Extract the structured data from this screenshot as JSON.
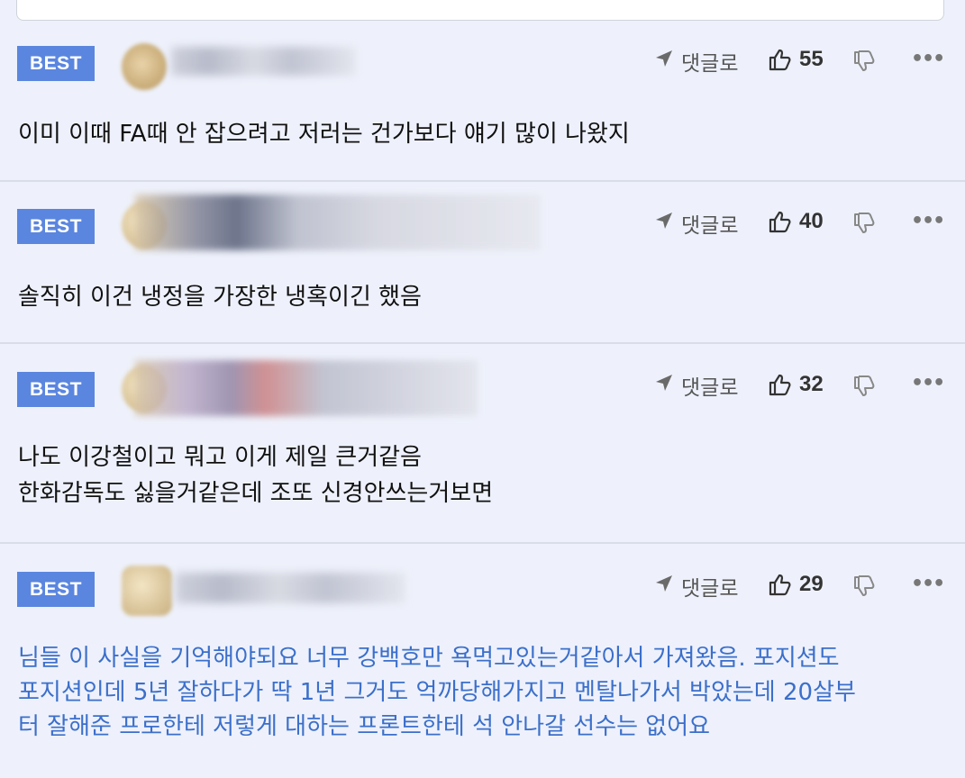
{
  "comments": [
    {
      "badge": "BEST",
      "reply_label": "댓글로",
      "likes": "55",
      "more": "•••",
      "text": "이미 이때 FA때 안 잡으려고 저러는 건가보다 얘기 많이 나왔지"
    },
    {
      "badge": "BEST",
      "reply_label": "댓글로",
      "likes": "40",
      "more": "•••",
      "text": "솔직히 이건 냉정을 가장한 냉혹이긴 했음"
    },
    {
      "badge": "BEST",
      "reply_label": "댓글로",
      "likes": "32",
      "more": "•••",
      "text": "나도 이강철이고 뭐고 이게 제일 큰거같음\n한화감독도 싫을거같은데 조또 신경안쓰는거보면"
    },
    {
      "badge": "BEST",
      "reply_label": "댓글로",
      "likes": "29",
      "more": "•••",
      "text": "님들 이 사실을 기억해야되요 너무 강백호만 욕먹고있는거같아서 가져왔음. 포지션도\n포지션인데 5년 잘하다가 딱 1년 그거도 억까당해가지고 멘탈나가서 박았는데 20살부\n터 잘해준 프로한테 저렇게 대하는 프론트한테 석 안나갈 선수는 없어요"
    }
  ],
  "icons": {
    "reply": "reply-arrow-icon",
    "like": "thumbs-up-icon",
    "dislike": "thumbs-down-icon",
    "more": "more-icon"
  },
  "colors": {
    "badge": "#5b86df",
    "background": "#eef1fb",
    "highlight_text": "#3b6fcb"
  }
}
